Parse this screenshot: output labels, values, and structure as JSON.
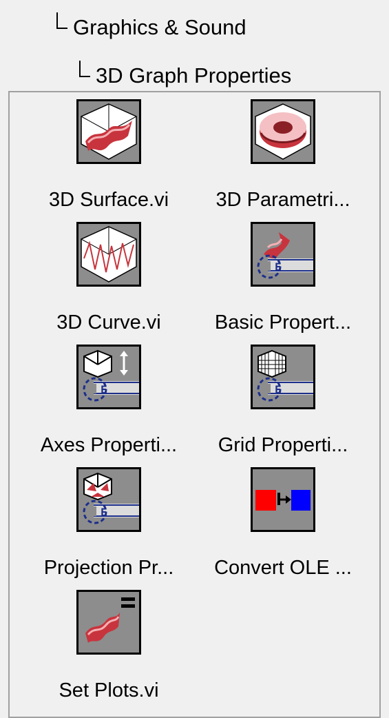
{
  "breadcrumb": {
    "level1": "Graphics & Sound",
    "level2": "3D Graph Properties"
  },
  "palette": {
    "items": [
      {
        "label": "3D Surface.vi",
        "icon": "3d-surface-icon"
      },
      {
        "label": "3D Parametri...",
        "icon": "3d-parametric-icon"
      },
      {
        "label": "3D Curve.vi",
        "icon": "3d-curve-icon"
      },
      {
        "label": "Basic Propert...",
        "icon": "basic-properties-icon"
      },
      {
        "label": "Axes Properti...",
        "icon": "axes-properties-icon"
      },
      {
        "label": "Grid Properti...",
        "icon": "grid-properties-icon"
      },
      {
        "label": "Projection Pr...",
        "icon": "projection-properties-icon"
      },
      {
        "label": "Convert OLE ...",
        "icon": "convert-ole-icon"
      },
      {
        "label": "Set Plots.vi",
        "icon": "set-plots-icon"
      }
    ]
  },
  "colors": {
    "icon_bg": "#8d8d8d",
    "surface_red": "#c8343d",
    "ole_red": "#ff0000",
    "ole_blue": "#0000ff"
  }
}
